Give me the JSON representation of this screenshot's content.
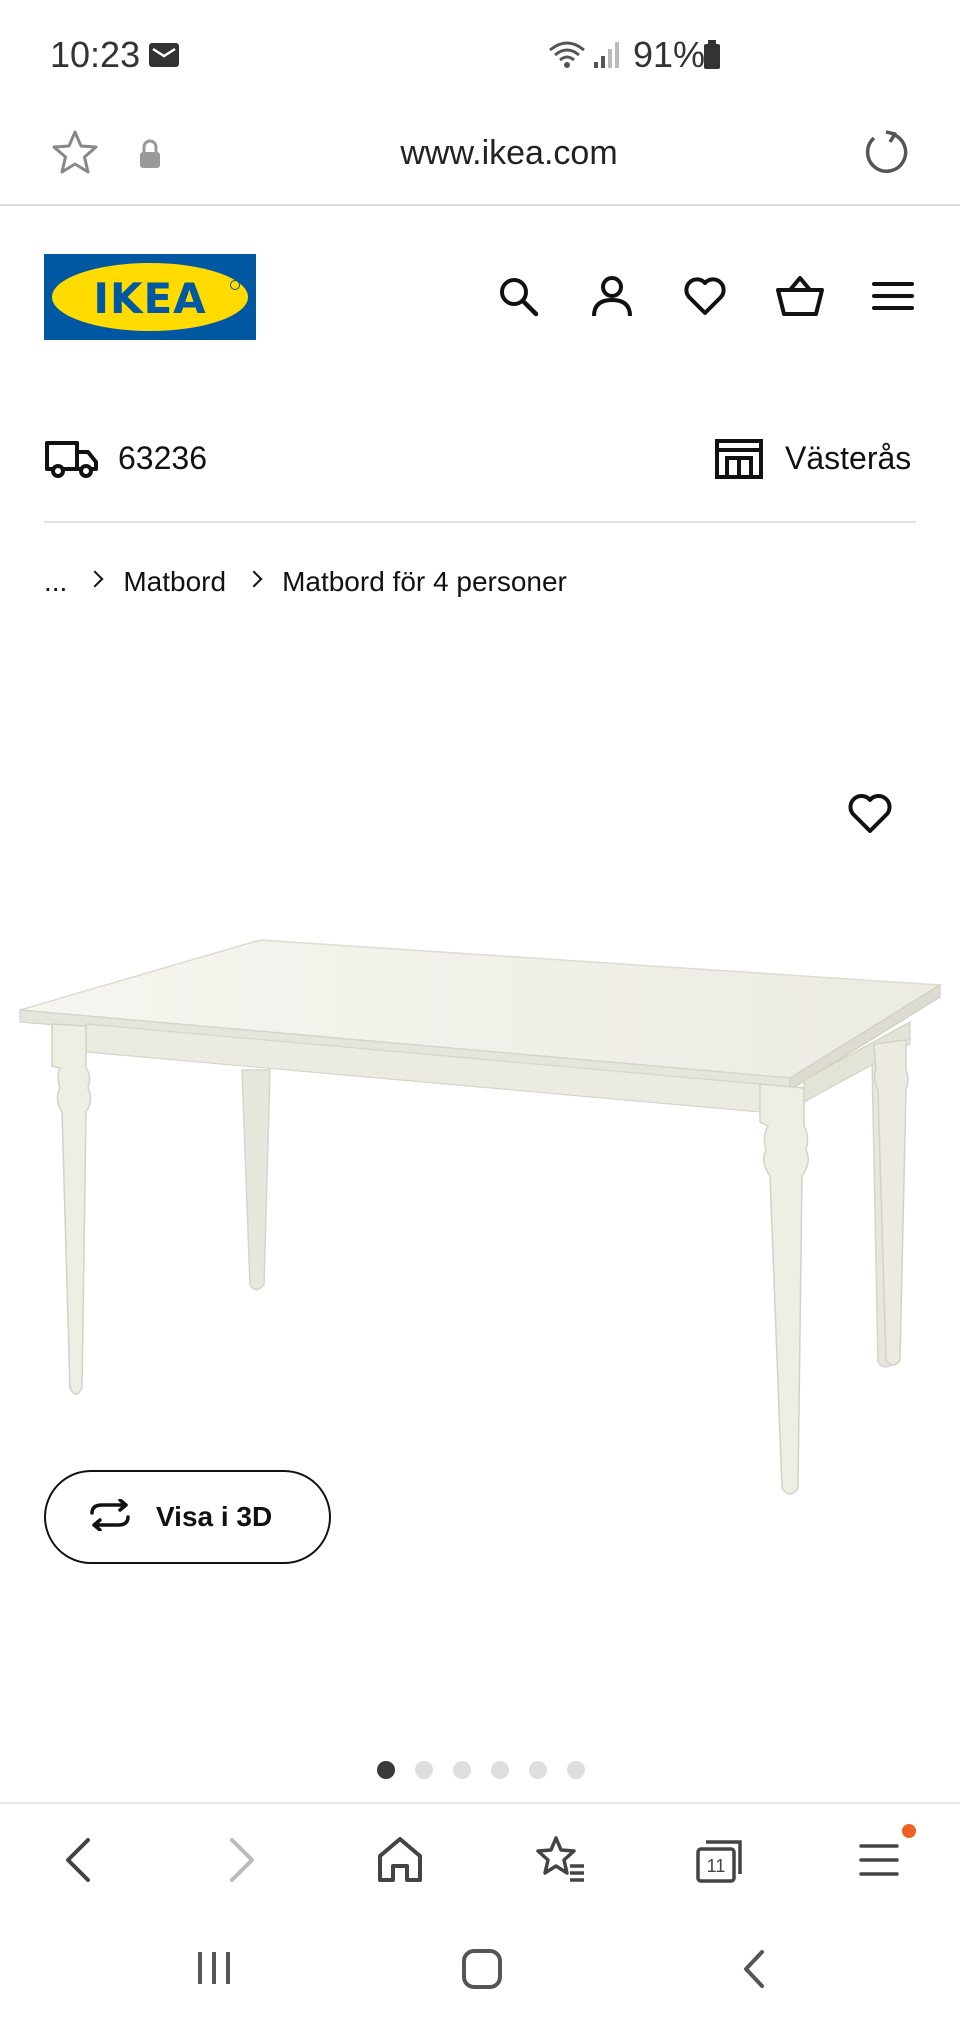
{
  "status_bar": {
    "time": "10:23",
    "battery": "91%",
    "icons": [
      "mail-icon",
      "wifi-icon",
      "signal-icon",
      "battery-icon"
    ]
  },
  "browser": {
    "url": "www.ikea.com",
    "icons": [
      "star-icon",
      "lock-icon",
      "reload-icon"
    ],
    "tab_count": "11",
    "toolbar_icons": [
      "back-icon",
      "forward-icon",
      "home-icon",
      "bookmarks-icon",
      "tabs-icon",
      "menu-icon"
    ]
  },
  "header": {
    "logo_text": "IKEA",
    "brand_colors": {
      "blue": "#0058a3",
      "yellow": "#ffdb00"
    },
    "icons": [
      "search-icon",
      "account-icon",
      "wishlist-icon",
      "cart-icon",
      "hamburger-icon"
    ]
  },
  "delivery": {
    "postal_code": "63236",
    "store": "Västerås"
  },
  "breadcrumb": {
    "items": [
      "...",
      "Matbord",
      "Matbord för 4 personer"
    ]
  },
  "product": {
    "image_alt": "white dining table",
    "view_3d_label": "Visa i 3D",
    "carousel": {
      "total": 6,
      "active": 0
    }
  },
  "android_nav": {
    "icons": [
      "recents-icon",
      "home-button-icon",
      "back-nav-icon"
    ]
  }
}
